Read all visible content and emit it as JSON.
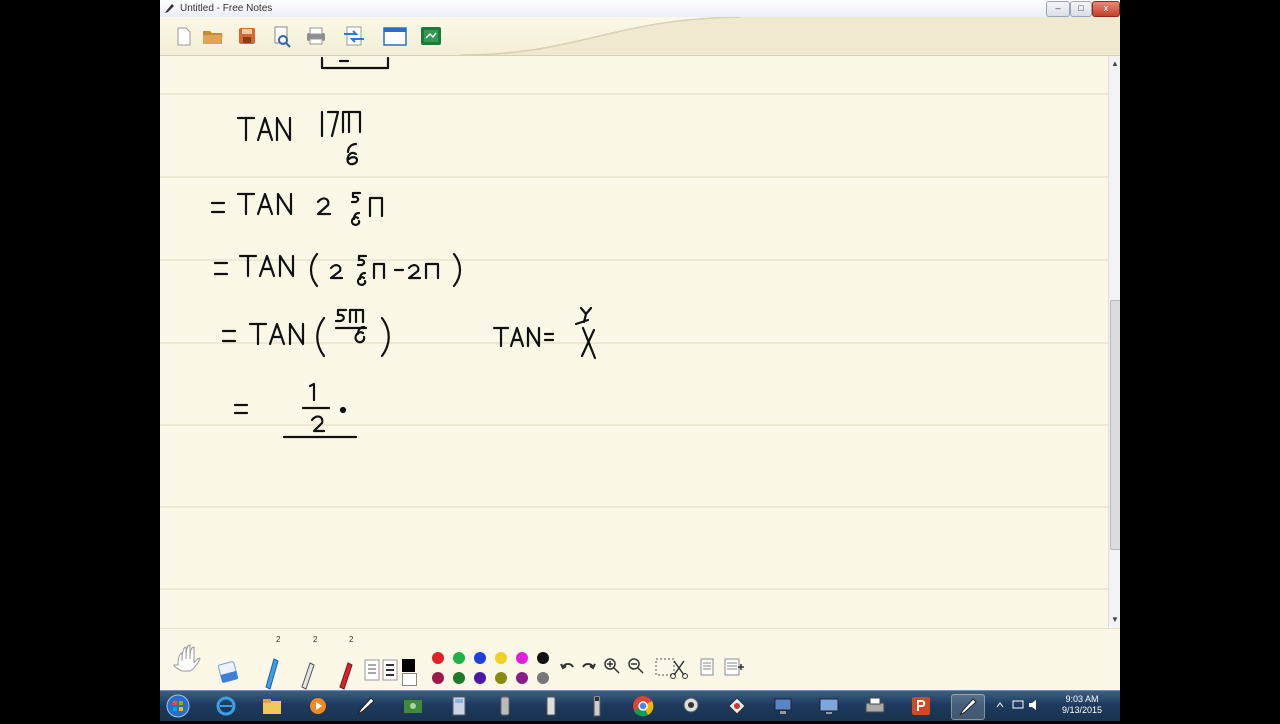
{
  "window": {
    "title": "Untitled - Free Notes"
  },
  "window_buttons": {
    "minimize": "–",
    "maximize": "□",
    "close": "x"
  },
  "toolbar": {
    "buttons": [
      "new-icon",
      "open-folder-icon",
      "save-icon",
      "print-preview-icon",
      "print-icon",
      "switch-icon",
      "window-icon",
      "board-icon"
    ]
  },
  "notes": {
    "lines": [
      "TAN 17π/6",
      "= TAN 2 5/6 π",
      "= TAN (2 5/6 π − 2π)",
      "= TAN (5π/6)",
      "TAN = y/x",
      "= 1/2"
    ]
  },
  "scrollbar": {
    "up": "▲",
    "down": "▼"
  },
  "palette": {
    "counts": [
      "2",
      "2",
      "2"
    ],
    "colors_top": [
      "#e0202a",
      "#22b04b",
      "#1f3fd8",
      "#f0d020",
      "#e020d8",
      "#111111"
    ],
    "colors_bottom": [
      "#a01848",
      "#1d7a2b",
      "#4b1aa0",
      "#8a8a10",
      "#8a1a8a",
      "#777777"
    ]
  },
  "clock": {
    "time": "9:03 AM",
    "date": "9/13/2015"
  },
  "taskbar": {
    "apps": [
      "start-orb-icon",
      "ie-icon",
      "explorer-icon",
      "media-icon",
      "pen-icon",
      "money-icon",
      "calculator-icon",
      "device-icon",
      "phone-icon",
      "usb-icon",
      "chrome-icon",
      "webcam-icon",
      "tool-icon",
      "network-icon",
      "monitor-icon",
      "printer-icon",
      "powerpoint-icon",
      "free-notes-icon"
    ]
  }
}
